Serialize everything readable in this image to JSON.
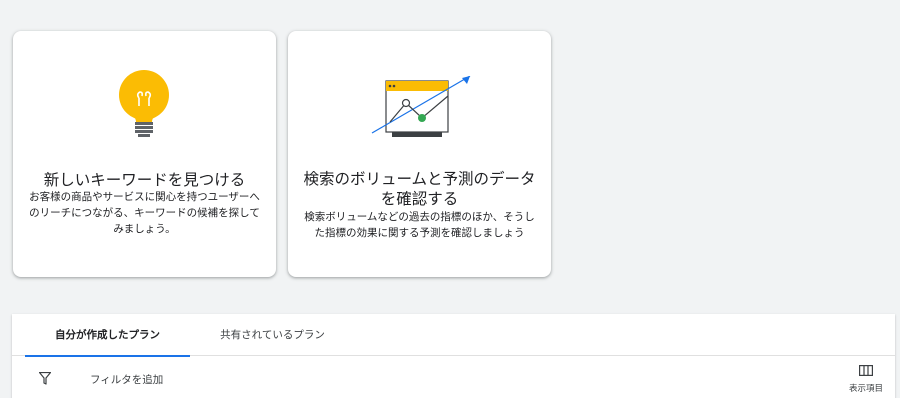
{
  "cards": [
    {
      "title": "新しいキーワードを見つける",
      "description": "お客様の商品やサービスに関心を持つユーザーへのリーチにつながる、キーワードの候補を探してみましょう。",
      "icon": "lightbulb-icon"
    },
    {
      "title": "検索のボリュームと予測のデータを確認する",
      "description": "検索ボリュームなどの過去の指標のほか、そうした指標の効果に関する予測を確認しましょう",
      "icon": "trend-chart-icon"
    }
  ],
  "plans": {
    "tabs": [
      {
        "label": "自分が作成したプラン",
        "selected": true
      },
      {
        "label": "共有されているプラン",
        "selected": false
      }
    ],
    "filter": {
      "label": "フィルタを追加",
      "icon": "filter-icon"
    },
    "columns": {
      "label": "表示項目",
      "icon": "columns-icon"
    }
  },
  "colors": {
    "accent": "#1a73e8",
    "lightbulb": "#fbbc04",
    "chart_point": "#34a853",
    "background": "#f1f3f4"
  }
}
